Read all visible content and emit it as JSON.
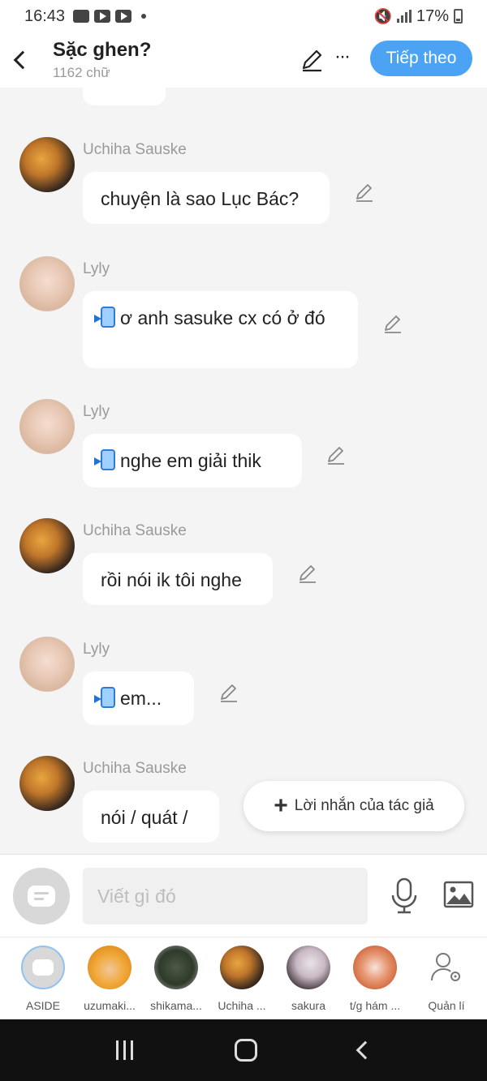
{
  "status_bar": {
    "time": "16:43",
    "battery": "17%"
  },
  "header": {
    "title": "Sặc ghen?",
    "word_count": "1162 chữ",
    "next_button": "Tiếp theo",
    "more_label": "···"
  },
  "messages": [
    {
      "sender": "Uchiha Sauske",
      "text": "chuyện là sao Lục Bác?"
    },
    {
      "sender": "Lyly",
      "text": "ơ anh sasuke cx có ở đó"
    },
    {
      "sender": "Lyly",
      "text": "nghe em giải thik"
    },
    {
      "sender": "Uchiha Sauske",
      "text": "rồi nói ik tôi nghe"
    },
    {
      "sender": "Lyly",
      "text": "em..."
    },
    {
      "sender": "Uchiha Sauske",
      "text": "nói / quát /"
    }
  ],
  "author_note_button": "Lời nhắn của tác giả",
  "input": {
    "placeholder": "Viết gì đó"
  },
  "characters": [
    {
      "label": "ASIDE"
    },
    {
      "label": "uzumaki..."
    },
    {
      "label": "shikama..."
    },
    {
      "label": "Uchiha ..."
    },
    {
      "label": "sakura"
    },
    {
      "label": "t/g hám ..."
    },
    {
      "label": "Quản lí"
    }
  ],
  "colors": {
    "accent": "#4da3f3",
    "background": "#f4f4f4",
    "bubble": "#ffffff"
  }
}
